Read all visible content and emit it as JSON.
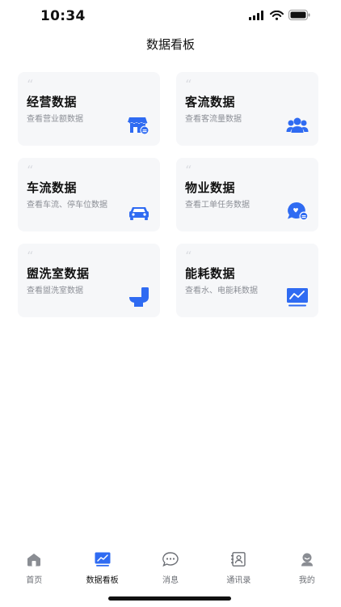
{
  "status_bar": {
    "time": "10:34"
  },
  "header": {
    "title": "数据看板"
  },
  "cards": [
    {
      "title": "经营数据",
      "desc": "查看营业额数据",
      "icon": "store-icon"
    },
    {
      "title": "客流数据",
      "desc": "查看客流量数据",
      "icon": "users-icon"
    },
    {
      "title": "车流数据",
      "desc": "查看车流、停车位数据",
      "icon": "car-icon"
    },
    {
      "title": "物业数据",
      "desc": "查看工单任务数据",
      "icon": "chat-bubble-icon"
    },
    {
      "title": "盥洗室数据",
      "desc": "查看盥洗室数据",
      "icon": "toilet-icon"
    },
    {
      "title": "能耗数据",
      "desc": "查看水、电能耗数据",
      "icon": "monitor-chart-icon"
    }
  ],
  "tab_bar": {
    "active_index": 1,
    "items": [
      {
        "label": "首页",
        "icon": "home-icon"
      },
      {
        "label": "数据看板",
        "icon": "dashboard-icon"
      },
      {
        "label": "消息",
        "icon": "message-icon"
      },
      {
        "label": "通讯录",
        "icon": "contacts-icon"
      },
      {
        "label": "我的",
        "icon": "profile-icon"
      }
    ]
  },
  "colors": {
    "accent": "#2f6bf2",
    "card_bg": "#f6f7f9",
    "tab_inactive": "#6b6e74"
  }
}
